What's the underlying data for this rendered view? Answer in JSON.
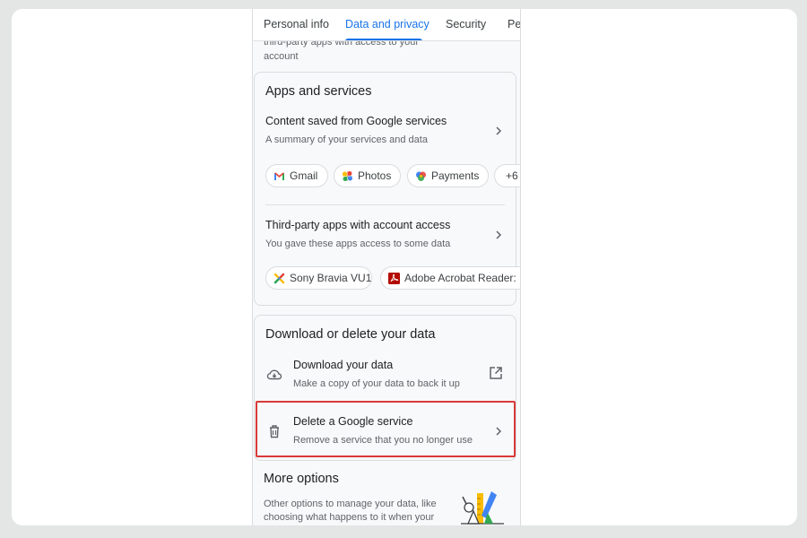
{
  "tabs": [
    {
      "label": "Personal info"
    },
    {
      "label": "Data and privacy",
      "active": true
    },
    {
      "label": "Security"
    },
    {
      "label": "Peo"
    }
  ],
  "previous_section": {
    "line1": "third-party apps with access to your",
    "line2": "account"
  },
  "apps_services": {
    "title": "Apps and services",
    "content_saved": {
      "title": "Content saved from Google services",
      "subtitle": "A summary of your services and data"
    },
    "service_chips": [
      {
        "label": "Gmail",
        "icon": "gmail-icon"
      },
      {
        "label": "Photos",
        "icon": "photos-icon"
      },
      {
        "label": "Payments",
        "icon": "payments-icon"
      },
      {
        "label": "+6"
      }
    ],
    "third_party": {
      "title": "Third-party apps with account access",
      "subtitle": "You gave these apps access to some data"
    },
    "app_chips": [
      {
        "label": "Sony Bravia VU1",
        "icon": "sony-bravia-icon"
      },
      {
        "label": "Adobe Acrobat Reader: I",
        "icon": "adobe-acrobat-icon"
      }
    ]
  },
  "download_delete": {
    "title": "Download or delete your data",
    "download": {
      "title": "Download your data",
      "subtitle": "Make a copy of your data to back it up",
      "icon": "cloud-download-icon"
    },
    "delete": {
      "title": "Delete a Google service",
      "subtitle": "Remove a service that you no longer use",
      "icon": "trash-icon"
    }
  },
  "more_options": {
    "title": "More options",
    "description_line1": "Other options to manage your data, like",
    "description_line2": "choosing what happens to it when your"
  },
  "colors": {
    "accent": "#1a73e8",
    "highlight": "#d93a3a"
  }
}
